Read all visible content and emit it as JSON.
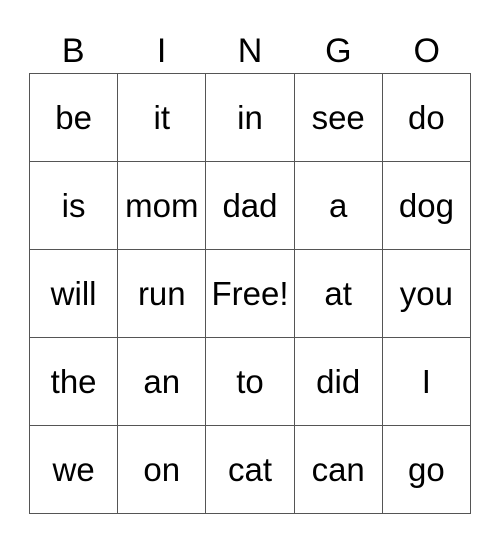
{
  "header": [
    "B",
    "I",
    "N",
    "G",
    "O"
  ],
  "rows": [
    [
      "be",
      "it",
      "in",
      "see",
      "do"
    ],
    [
      "is",
      "mom",
      "dad",
      "a",
      "dog"
    ],
    [
      "will",
      "run",
      "Free!",
      "at",
      "you"
    ],
    [
      "the",
      "an",
      "to",
      "did",
      "I"
    ],
    [
      "we",
      "on",
      "cat",
      "can",
      "go"
    ]
  ]
}
